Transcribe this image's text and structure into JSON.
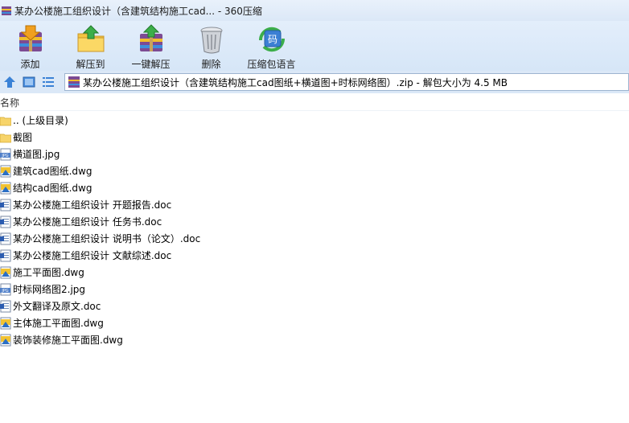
{
  "window": {
    "title": "某办公楼施工组织设计（含建筑结构施工cad... - 360压缩"
  },
  "toolbar": {
    "buttons": [
      {
        "label": "添加",
        "icon": "add-archive-icon"
      },
      {
        "label": "解压到",
        "icon": "extract-to-icon"
      },
      {
        "label": "一键解压",
        "icon": "one-click-extract-icon"
      },
      {
        "label": "删除",
        "icon": "trash-icon"
      },
      {
        "label": "压缩包语言",
        "icon": "archive-language-icon"
      }
    ]
  },
  "address": {
    "path": "某办公楼施工组织设计（含建筑结构施工cad图纸+横道图+时标网络图）.zip - 解包大小为 4.5 MB"
  },
  "list": {
    "header": "名称",
    "items": [
      {
        "name": ".. (上级目录)",
        "type": "folder"
      },
      {
        "name": "截图",
        "type": "folder"
      },
      {
        "name": "横道图.jpg",
        "type": "jpg"
      },
      {
        "name": "建筑cad图纸.dwg",
        "type": "dwg"
      },
      {
        "name": "结构cad图纸.dwg",
        "type": "dwg"
      },
      {
        "name": "某办公楼施工组织设计 开题报告.doc",
        "type": "doc"
      },
      {
        "name": "某办公楼施工组织设计 任务书.doc",
        "type": "doc"
      },
      {
        "name": "某办公楼施工组织设计 说明书（论文）.doc",
        "type": "doc"
      },
      {
        "name": "某办公楼施工组织设计 文献综述.doc",
        "type": "doc"
      },
      {
        "name": "施工平面图.dwg",
        "type": "dwg"
      },
      {
        "name": "时标网络图2.jpg",
        "type": "jpg"
      },
      {
        "name": "外文翻译及原文.doc",
        "type": "doc"
      },
      {
        "name": "主体施工平面图.dwg",
        "type": "dwg"
      },
      {
        "name": "装饰装修施工平面图.dwg",
        "type": "dwg"
      }
    ]
  }
}
